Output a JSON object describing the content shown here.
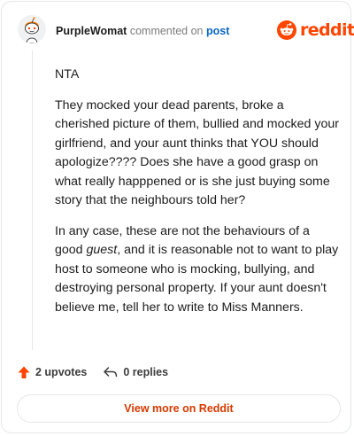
{
  "header": {
    "author": "PurpleWomat",
    "action": "commented on",
    "target": "post",
    "brand": "reddit"
  },
  "comment": {
    "paragraphs": [
      {
        "parts": [
          {
            "text": "NTA"
          }
        ]
      },
      {
        "parts": [
          {
            "text": "They mocked your dead parents, broke a cherished picture of them, bullied and mocked your girlfriend, and your aunt thinks that YOU should apologize???? Does she have a good grasp on what really happpened or is she just buying some story that the neighbours told her?"
          }
        ]
      },
      {
        "parts": [
          {
            "text": "In any case, these are not the behaviours of a good "
          },
          {
            "text": "guest",
            "italic": true
          },
          {
            "text": ", and it is reasonable not to want to play host to someone who is mocking, bullying, and destroying personal property. If your aunt doesn't believe me, tell her to write to Miss Manners."
          }
        ]
      }
    ]
  },
  "footer": {
    "upvotes": "2 upvotes",
    "replies": "0 replies",
    "view_more": "View more on Reddit"
  },
  "colors": {
    "brand": "#ff4500",
    "link": "#0a66c2",
    "cta": "#d93900"
  },
  "icons": {
    "avatar": "reddit-snoo-avatar",
    "brand": "reddit-logo-icon",
    "upvote": "upvote-arrow-icon",
    "reply": "reply-arrow-icon"
  }
}
